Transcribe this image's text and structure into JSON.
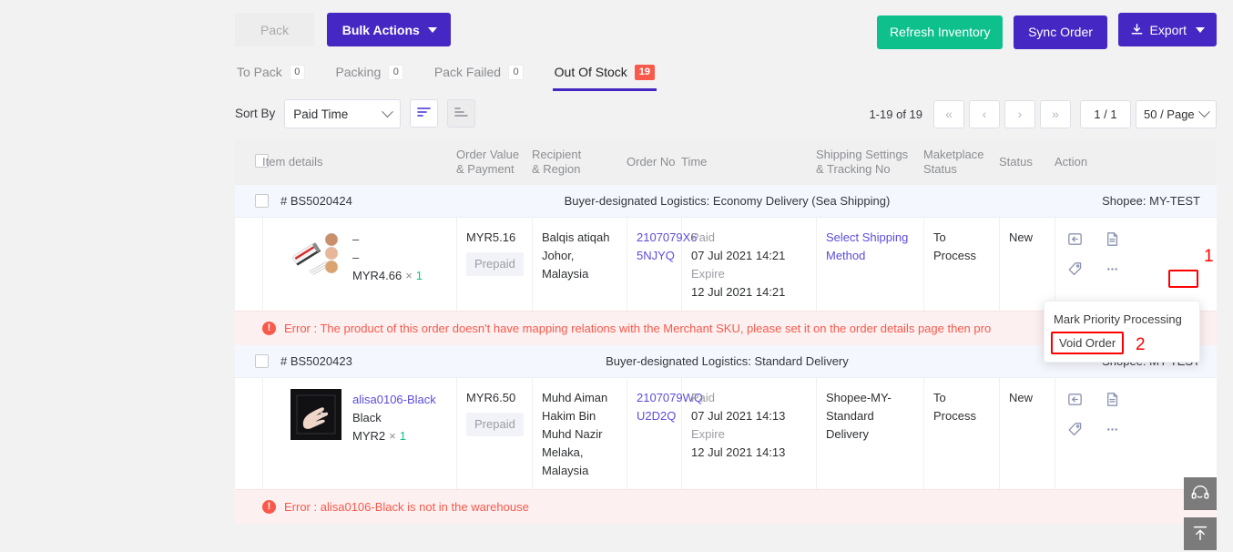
{
  "toolbar": {
    "pack_label": "Pack",
    "bulk_actions_label": "Bulk Actions",
    "refresh_inventory_label": "Refresh Inventory",
    "sync_order_label": "Sync Order",
    "export_label": "Export"
  },
  "tabs": [
    {
      "label": "To Pack",
      "count": "0",
      "active": false
    },
    {
      "label": "Packing",
      "count": "0",
      "active": false
    },
    {
      "label": "Pack Failed",
      "count": "0",
      "active": false
    },
    {
      "label": "Out Of Stock",
      "count": "19",
      "active": true
    }
  ],
  "sort": {
    "label": "Sort By",
    "selected": "Paid Time",
    "desc_icon": "sort-descending-icon",
    "asc_icon": "sort-ascending-icon"
  },
  "pagination": {
    "range": "1-19 of 19",
    "first": "«",
    "prev": "‹",
    "next": "›",
    "last": "»",
    "page": "1 / 1",
    "page_size": "50 / Page"
  },
  "columns": {
    "item_details": "Item details",
    "order_value": "Order Value",
    "order_value_2": "& Payment",
    "recipient": "Recipient",
    "recipient_2": "& Region",
    "order_no": "Order No",
    "time": "Time",
    "shipping": "Shipping Settings",
    "shipping_2": "& Tracking No",
    "marketplace": "Maketplace",
    "marketplace_2": "Status",
    "status": "Status",
    "action": "Action"
  },
  "orders": [
    {
      "id": "# BS5020424",
      "logistics": "Buyer-designated Logistics: Economy Delivery (Sea Shipping)",
      "shop": "Shopee: MY-TEST",
      "item": {
        "name_line1": "–",
        "name_line2": "–",
        "price": "MYR4.66",
        "x": "×",
        "qty": "1",
        "thumb": "hair-straightener-product-image"
      },
      "order_value": "MYR5.16",
      "payment": "Prepaid",
      "recipient_name": "Balqis atiqah",
      "recipient_region": "Johor, Malaysia",
      "order_no_line1": "2107079X6",
      "order_no_line2": "5NJYQ",
      "paid_label": "Paid",
      "paid_time": "07 Jul 2021 14:21",
      "expire_label": "Expire",
      "expire_time": "12 Jul 2021 14:21",
      "shipping_line1": "Select Shipping",
      "shipping_line2": "Method",
      "shipping_is_link": true,
      "marketplace_status": "To Process",
      "status": "New",
      "error": "Error :  The product of this order doesn't have mapping relations with the Merchant SKU, please set it on the order details page then pro"
    },
    {
      "id": "# BS5020423",
      "logistics": "Buyer-designated Logistics: Standard Delivery",
      "shop": "Shopee: MY-TEST",
      "item": {
        "name_line1": "alisa0106-Black",
        "name_line2": "Black",
        "price": "MYR2",
        "x": "×",
        "qty": "1",
        "thumb": "hand-with-ring-product-image"
      },
      "order_value": "MYR6.50",
      "payment": "Prepaid",
      "recipient_name": "Muhd Aiman Hakim Bin Muhd Nazir",
      "recipient_region": "Melaka, Malaysia",
      "order_no_line1": "2107079WQ",
      "order_no_line2": "U2D2Q",
      "paid_label": "Paid",
      "paid_time": "07 Jul 2021 14:13",
      "expire_label": "Expire",
      "expire_time": "12 Jul 2021 14:13",
      "shipping_line1": "Shopee-MY-",
      "shipping_line2": "Standard Delivery",
      "shipping_is_link": false,
      "marketplace_status": "To Process",
      "status": "New",
      "error": "Error : alisa0106-Black is not in the warehouse"
    }
  ],
  "action_icons": {
    "reship": "return-arrow-icon",
    "invoice": "document-icon",
    "tag": "tag-icon",
    "more": "more-ellipsis-icon"
  },
  "dropdown": {
    "items": [
      {
        "label": "Mark Priority Processing",
        "highlighted": false
      },
      {
        "label": "Void Order",
        "highlighted": true
      }
    ]
  },
  "annotations": [
    {
      "number": "1"
    },
    {
      "number": "2"
    }
  ],
  "floating": {
    "support": "headset-support-icon",
    "back_to_top": "back-to-top-icon"
  },
  "colors": {
    "primary": "#4527c4",
    "success": "#0ec18c",
    "danger": "#f8594b",
    "link": "#5b4ddb",
    "annotation": "#ff0000"
  }
}
